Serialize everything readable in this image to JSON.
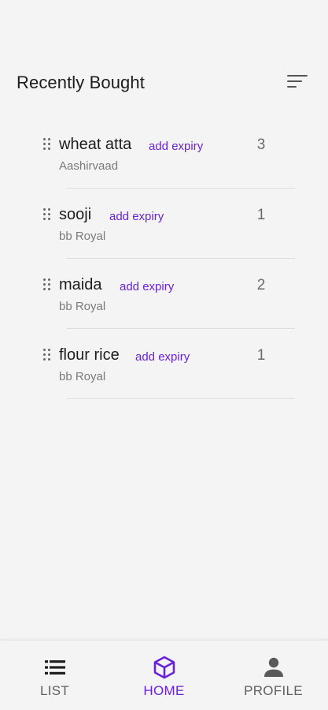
{
  "header": {
    "title": "Recently Bought",
    "sort_icon": "sort-lines-icon"
  },
  "items": [
    {
      "name": "wheat atta",
      "action": "add expiry",
      "brand": "Aashirvaad",
      "quantity": "3"
    },
    {
      "name": "sooji",
      "action": "add expiry",
      "brand": "bb Royal",
      "quantity": "1"
    },
    {
      "name": "maida",
      "action": "add expiry",
      "brand": "bb Royal",
      "quantity": "2"
    },
    {
      "name": "flour rice",
      "action": "add expiry",
      "brand": "bb Royal",
      "quantity": "1"
    }
  ],
  "nav": {
    "list_label": "LIST",
    "home_label": "HOME",
    "profile_label": "PROFILE",
    "active": "home"
  },
  "colors": {
    "accent": "#6a22d6",
    "background": "#f4f4f5",
    "text_primary": "#1d1d1d",
    "text_secondary": "#7a7a7a",
    "nav_inactive": "#5f5f5f"
  }
}
